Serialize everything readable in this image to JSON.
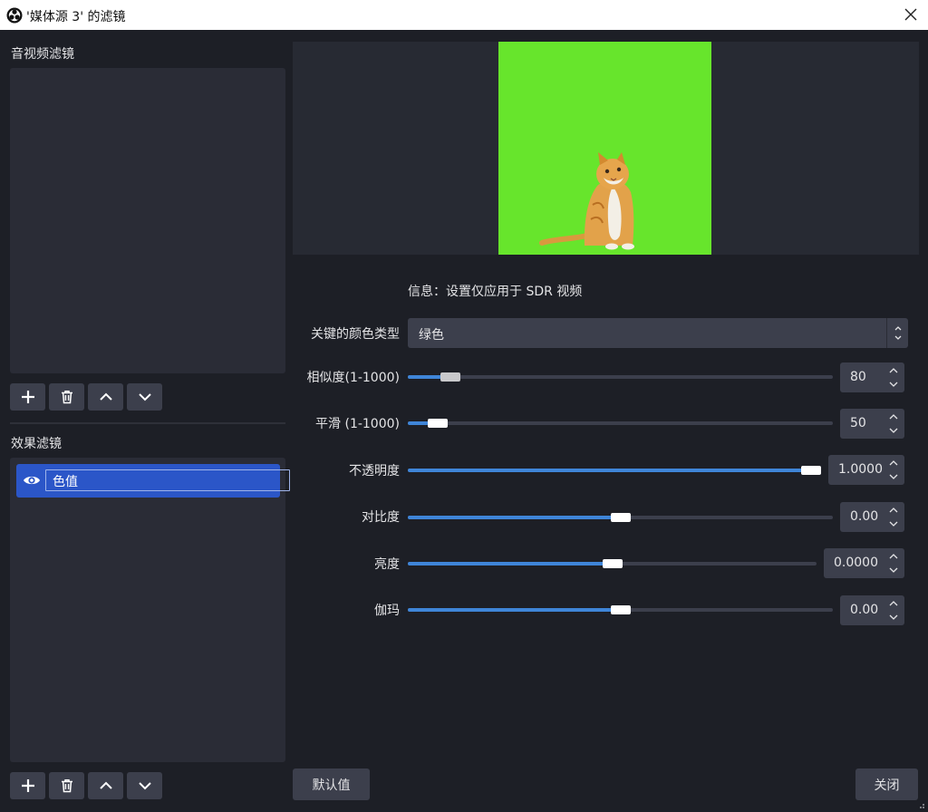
{
  "window": {
    "title": "'媒体源 3' 的滤镜",
    "app_icon": "obs-logo-icon",
    "close_icon": "close-icon"
  },
  "left_panel": {
    "av_filters": {
      "label": "音视频滤镜",
      "items": []
    },
    "effect_filters": {
      "label": "效果滤镜",
      "items": [
        {
          "name": "色值",
          "visible": true,
          "selected": true,
          "icon": "eye-icon"
        }
      ]
    },
    "buttons": [
      {
        "icon": "plus-icon"
      },
      {
        "icon": "trash-icon"
      },
      {
        "icon": "chevron-up-icon"
      },
      {
        "icon": "chevron-down-icon"
      }
    ]
  },
  "preview": {
    "background_color": "#67e52c",
    "subject": "cat-image"
  },
  "info_text": "信息：设置仅应用于 SDR 视频",
  "properties": {
    "key_color_type": {
      "label": "关键的颜色类型",
      "value": "绿色"
    },
    "similarity": {
      "label": "相似度(1-1000)",
      "value": "80",
      "fraction": 0.08
    },
    "smoothness": {
      "label": "平滑 (1-1000)",
      "value": "50",
      "fraction": 0.05
    },
    "opacity": {
      "label": "不透明度",
      "value": "1.0000",
      "fraction": 1.0
    },
    "contrast": {
      "label": "对比度",
      "value": "0.00",
      "fraction": 0.5
    },
    "brightness": {
      "label": "亮度",
      "value": "0.0000",
      "fraction": 0.5
    },
    "gamma": {
      "label": "伽玛",
      "value": "0.00",
      "fraction": 0.5
    }
  },
  "footer": {
    "defaults_label": "默认值",
    "close_label": "关闭"
  },
  "colors": {
    "background": "#1d1f26",
    "panel": "#2a2c36",
    "control": "#3c3f4c",
    "accent": "#3f85d8",
    "selection": "#2b56c8"
  }
}
